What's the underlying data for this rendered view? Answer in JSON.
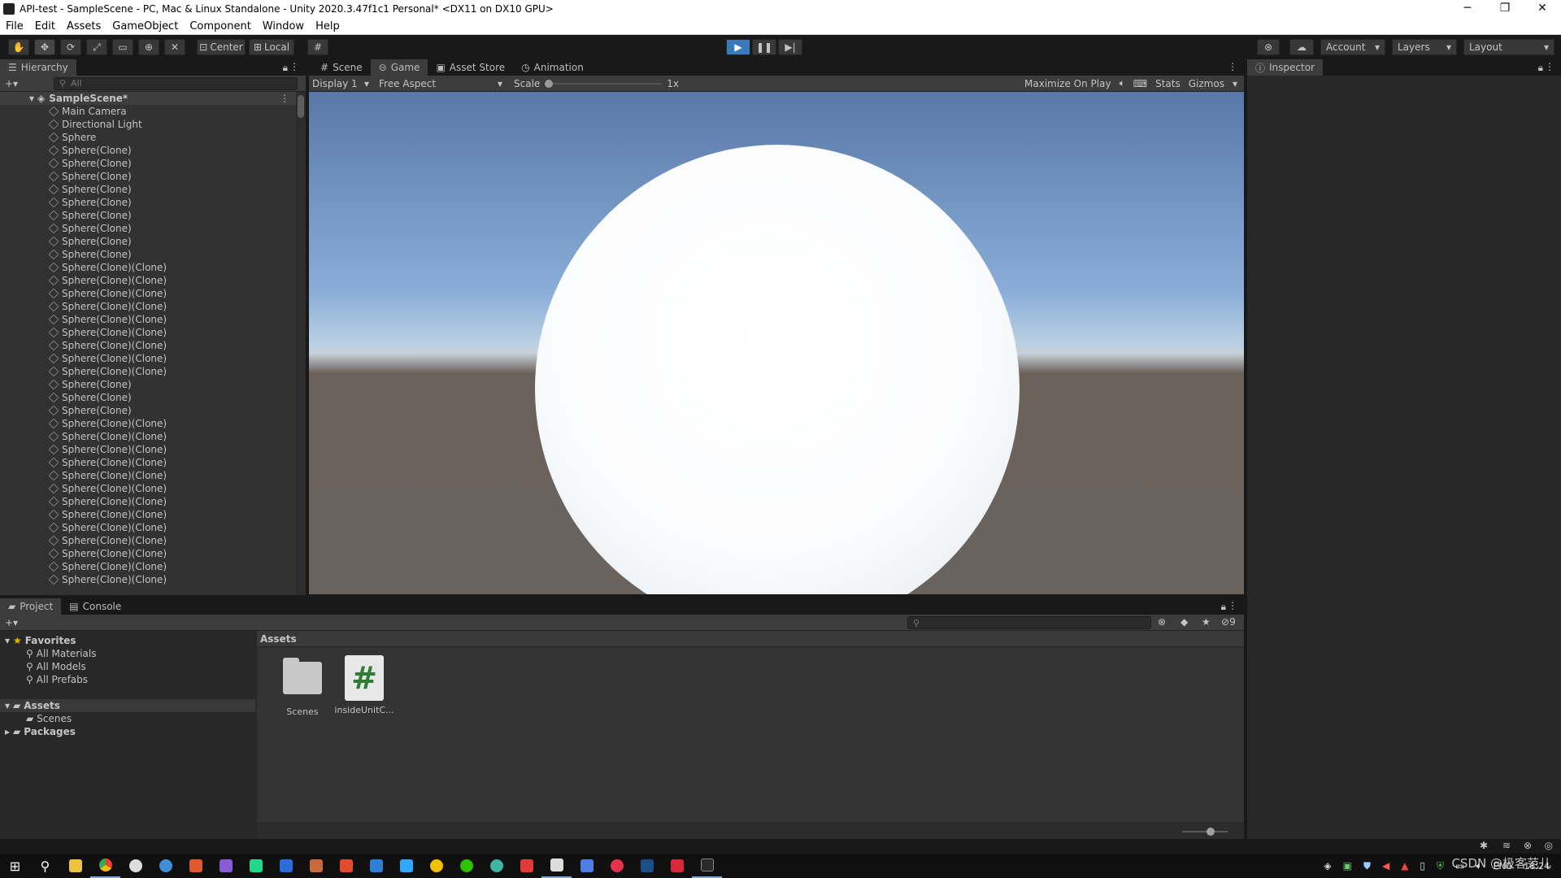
{
  "window": {
    "title": "API-test - SampleScene - PC, Mac & Linux Standalone - Unity 2020.3.47f1c1 Personal* <DX11 on DX10 GPU>",
    "controls": [
      "─",
      "❐",
      "✕"
    ]
  },
  "menu": [
    "File",
    "Edit",
    "Assets",
    "GameObject",
    "Component",
    "Window",
    "Help"
  ],
  "toolbar": {
    "pivot_label": "Center",
    "space_label": "Local",
    "account_label": "Account",
    "layers_label": "Layers",
    "layout_label": "Layout"
  },
  "hierarchy": {
    "tab_label": "Hierarchy",
    "search_placeholder": "All",
    "scene_name": "SampleScene*",
    "items": [
      "Main Camera",
      "Directional Light",
      "Sphere",
      "Sphere(Clone)",
      "Sphere(Clone)",
      "Sphere(Clone)",
      "Sphere(Clone)",
      "Sphere(Clone)",
      "Sphere(Clone)",
      "Sphere(Clone)",
      "Sphere(Clone)",
      "Sphere(Clone)",
      "Sphere(Clone)(Clone)",
      "Sphere(Clone)(Clone)",
      "Sphere(Clone)(Clone)",
      "Sphere(Clone)(Clone)",
      "Sphere(Clone)(Clone)",
      "Sphere(Clone)(Clone)",
      "Sphere(Clone)(Clone)",
      "Sphere(Clone)(Clone)",
      "Sphere(Clone)(Clone)",
      "Sphere(Clone)",
      "Sphere(Clone)",
      "Sphere(Clone)",
      "Sphere(Clone)(Clone)",
      "Sphere(Clone)(Clone)",
      "Sphere(Clone)(Clone)",
      "Sphere(Clone)(Clone)",
      "Sphere(Clone)(Clone)",
      "Sphere(Clone)(Clone)",
      "Sphere(Clone)(Clone)",
      "Sphere(Clone)(Clone)",
      "Sphere(Clone)(Clone)",
      "Sphere(Clone)(Clone)",
      "Sphere(Clone)(Clone)",
      "Sphere(Clone)(Clone)",
      "Sphere(Clone)(Clone)"
    ]
  },
  "center_tabs": [
    "Scene",
    "Game",
    "Asset Store",
    "Animation"
  ],
  "game_bar": {
    "display": "Display 1",
    "aspect": "Free Aspect",
    "scale_label": "Scale",
    "scale_value": "1x",
    "maximize": "Maximize On Play",
    "stats": "Stats",
    "gizmos": "Gizmos"
  },
  "inspector": {
    "tab_label": "Inspector"
  },
  "bottom_tabs": [
    "Project",
    "Console"
  ],
  "project": {
    "favorites_label": "Favorites",
    "favorites": [
      "All Materials",
      "All Models",
      "All Prefabs"
    ],
    "assets_label": "Assets",
    "asset_children": [
      "Scenes"
    ],
    "packages_label": "Packages",
    "breadcrumb": "Assets",
    "hidden_count": "9",
    "files": [
      {
        "name": "Scenes",
        "type": "folder"
      },
      {
        "name": "insideUnitC...",
        "type": "script",
        "glyph": "#"
      }
    ]
  },
  "taskbar": {
    "lang": "ENG",
    "time": "18:24",
    "watermark": "CSDN @极客范儿"
  }
}
